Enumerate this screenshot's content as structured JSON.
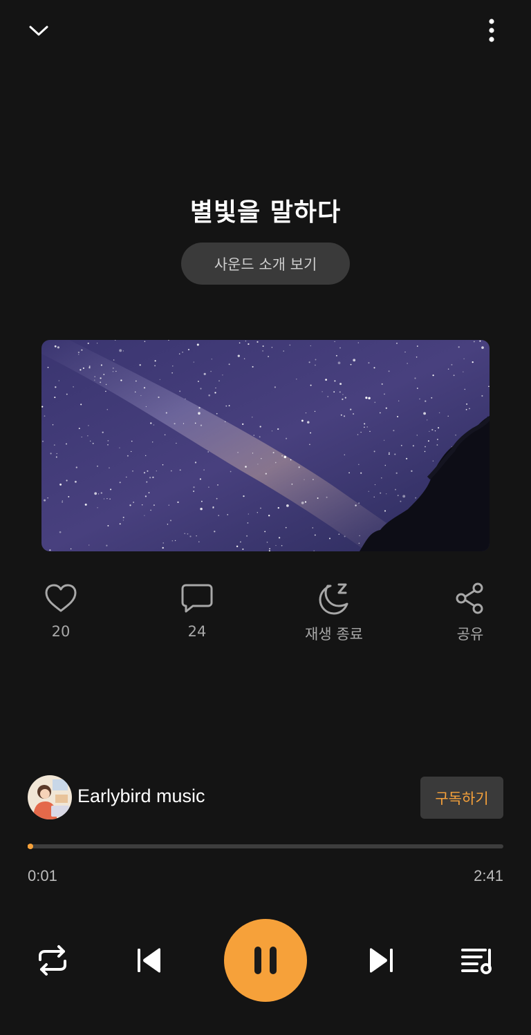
{
  "header": {
    "collapse_icon": "chevron-down-icon",
    "more_icon": "more-vertical-icon"
  },
  "track": {
    "title": "별빛을 말하다",
    "intro_button_label": "사운드 소개 보기"
  },
  "actions": {
    "like": {
      "icon": "heart-icon",
      "label": "20"
    },
    "comment": {
      "icon": "comment-icon",
      "label": "24"
    },
    "sleep_timer": {
      "icon": "moon-sleep-icon",
      "label": "재생 종료"
    },
    "share": {
      "icon": "share-icon",
      "label": "공유"
    }
  },
  "channel": {
    "name": "Earlybird music",
    "subscribe_label": "구독하기"
  },
  "player": {
    "elapsed": "0:01",
    "total": "2:41",
    "progress_fraction": 0.006
  },
  "controls": {
    "repeat_icon": "repeat-icon",
    "prev_icon": "skip-previous-icon",
    "play_pause_icon": "pause-icon",
    "next_icon": "skip-next-icon",
    "playlist_icon": "playlist-icon"
  },
  "colors": {
    "background": "#141414",
    "accent": "#f6a13a",
    "surface": "#3a3a3a",
    "muted_text": "#a8a8a8"
  }
}
